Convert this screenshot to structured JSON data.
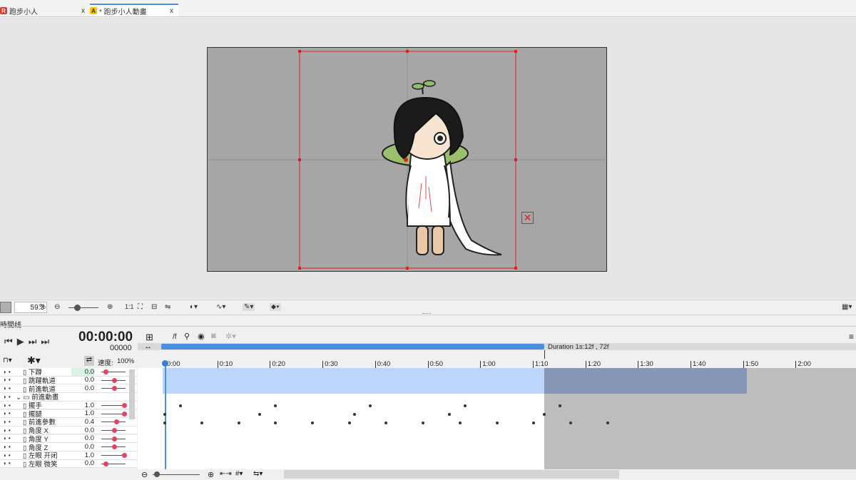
{
  "tabs": [
    {
      "label": "跑步小人"
    },
    {
      "label": "* 跑步小人動畫"
    }
  ],
  "tab_close": "x",
  "zoom": {
    "value": "59.3",
    "unit": "%",
    "ratio_label": "1:1"
  },
  "timeline": {
    "panel_title": "時間线",
    "timecode": "00:00:00",
    "frame": "00000",
    "speed_label": "速度:",
    "speed_value": "100%",
    "fx_label": "/f",
    "duration_label": "Duration 1s:12f , 72f",
    "ticks": [
      "0:00",
      "0:10",
      "0:20",
      "0:30",
      "0:40",
      "0:50",
      "1:00",
      "1:10",
      "1:20",
      "1:30",
      "1:40",
      "1:50",
      "2:00"
    ]
  },
  "params": [
    {
      "name": "下蹲",
      "value": "0.0",
      "pos": 0.1
    },
    {
      "name": "跳躍軌道",
      "value": "0.0",
      "pos": 0.5
    },
    {
      "name": "前進軌道",
      "value": "0.0",
      "pos": 0.5
    },
    {
      "name": "前進動畫",
      "value": "",
      "pos": null,
      "group": true
    },
    {
      "name": "擺手",
      "value": "1.0",
      "pos": 0.95
    },
    {
      "name": "擺腿",
      "value": "1.0",
      "pos": 0.95
    },
    {
      "name": "前進參數",
      "value": "0.4",
      "pos": 0.6
    },
    {
      "name": "角度 X",
      "value": "0.0",
      "pos": 0.5
    },
    {
      "name": "角度 Y",
      "value": "0.0",
      "pos": 0.5
    },
    {
      "name": "角度 Z",
      "value": "0.0",
      "pos": 0.5
    },
    {
      "name": "左眼 开闭",
      "value": "1.0",
      "pos": 0.95
    },
    {
      "name": "左眼 微笑",
      "value": "0.0",
      "pos": 0.1
    }
  ],
  "colors": {
    "accent": "#4a8fe0",
    "key_red": "#e8435e",
    "selection": "#e02020"
  }
}
